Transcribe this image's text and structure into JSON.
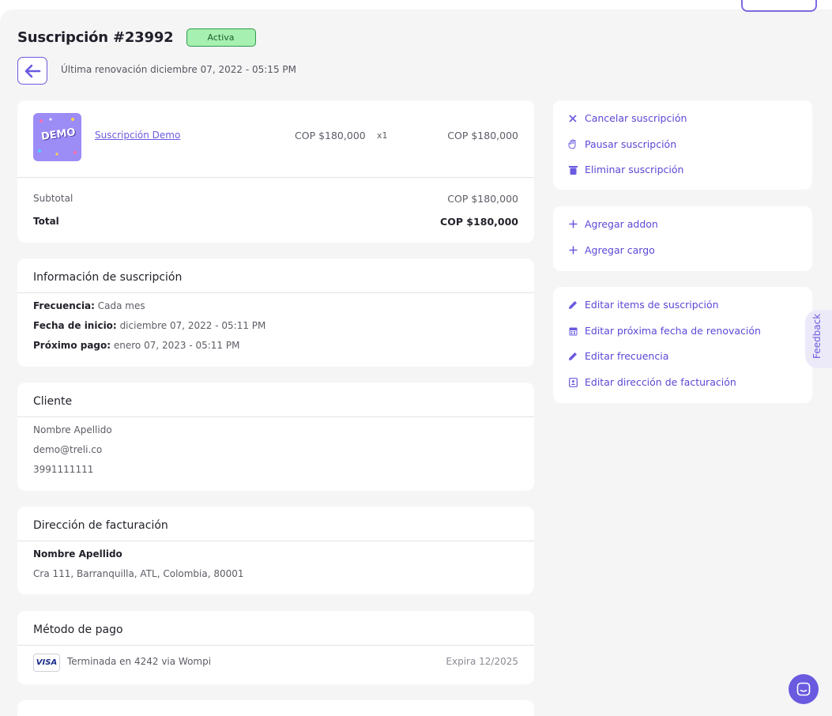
{
  "header": {
    "title": "Suscripción #23992",
    "status": "Activa",
    "renewal": "Última renovación diciembre 07, 2022 - 05:15 PM"
  },
  "order": {
    "thumb_text": "DEMO",
    "product_name": "Suscripción Demo",
    "unit_price": "COP $180,000",
    "quantity": "x1",
    "line_total": "COP $180,000",
    "subtotal_label": "Subtotal",
    "subtotal_value": "COP $180,000",
    "total_label": "Total",
    "total_value": "COP $180,000"
  },
  "subscription_info": {
    "title": "Información de suscripción",
    "frequency_label": "Frecuencia:",
    "frequency_value": "Cada mes",
    "start_label": "Fecha de inicio:",
    "start_value": "diciembre 07, 2022 - 05:11 PM",
    "next_label": "Próximo pago:",
    "next_value": "enero 07, 2023 - 05:11 PM"
  },
  "client": {
    "title": "Cliente",
    "name": "Nombre Apellido",
    "email": "demo@treli.co",
    "phone": "3991111111"
  },
  "billing": {
    "title": "Dirección de facturación",
    "name": "Nombre Apellido",
    "address": "Cra 111, Barranquilla, ATL, Colombia, 80001"
  },
  "payment": {
    "title": "Método de pago",
    "card_brand": "VISA",
    "card_text": "Terminada en 4242 via Wompi",
    "expiry": "Expira 12/2025"
  },
  "actions_primary": [
    {
      "label": "Cancelar suscripción",
      "icon": "close-icon"
    },
    {
      "label": "Pausar suscripción",
      "icon": "hand-icon"
    },
    {
      "label": "Eliminar suscripción",
      "icon": "trash-icon"
    }
  ],
  "actions_add": [
    {
      "label": "Agregar addon",
      "icon": "plus-icon"
    },
    {
      "label": "Agregar cargo",
      "icon": "plus-icon"
    }
  ],
  "actions_edit": [
    {
      "label": "Editar items de suscripción",
      "icon": "pencil-icon"
    },
    {
      "label": "Editar próxima fecha de renovación",
      "icon": "calendar-icon"
    },
    {
      "label": "Editar frecuencia",
      "icon": "pencil-icon"
    },
    {
      "label": "Editar dirección de facturación",
      "icon": "address-card-icon"
    }
  ],
  "feedback_label": "Feedback",
  "colors": {
    "accent": "#6a5ae0",
    "badge_bg": "#a6f0b2",
    "badge_border": "#2f9b4a",
    "page_bg": "#f5f5f6"
  }
}
